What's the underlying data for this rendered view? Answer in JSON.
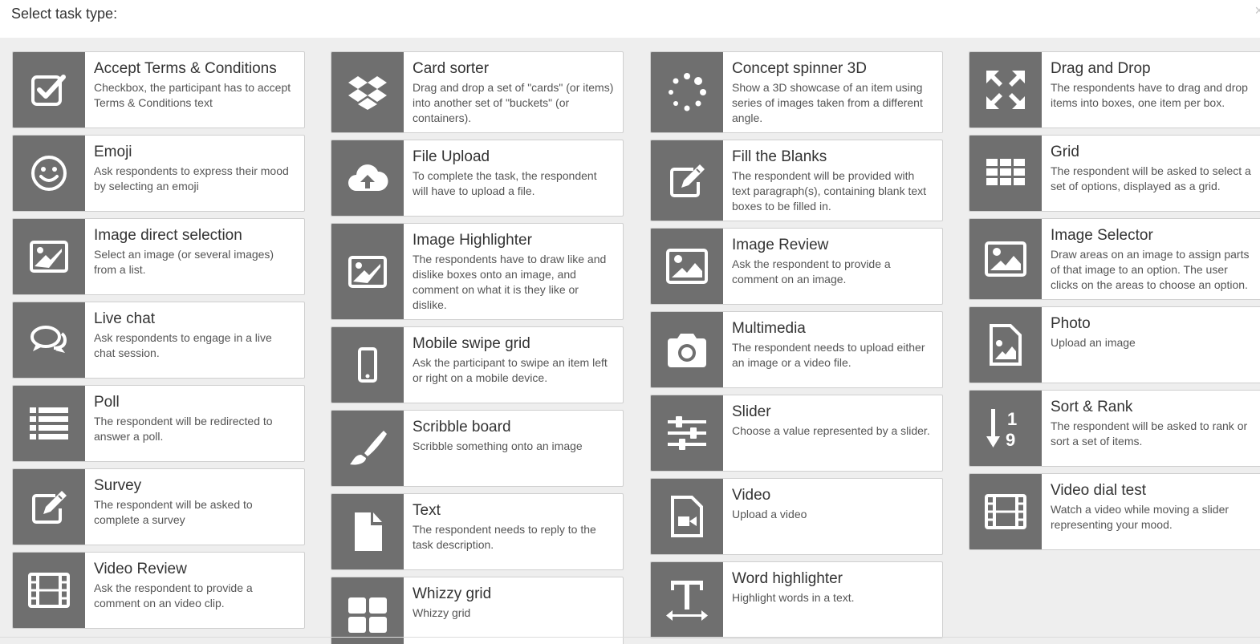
{
  "header": {
    "title": "Select task type:",
    "close_label": "×"
  },
  "columns": [
    [
      {
        "title": "Accept Terms & Conditions",
        "desc": "Checkbox, the participant has to accept Terms & Conditions text",
        "icon": "checkbox-icon"
      },
      {
        "title": "Emoji",
        "desc": "Ask respondents to express their mood by selecting an emoji",
        "icon": "smiley-icon"
      },
      {
        "title": "Image direct selection",
        "desc": "Select an image (or several images) from a list.",
        "icon": "image-selection-icon"
      },
      {
        "title": "Live chat",
        "desc": "Ask respondents to engage in a live chat session.",
        "icon": "chat-bubbles-icon"
      },
      {
        "title": "Poll",
        "desc": "The respondent will be redirected to answer a poll.",
        "icon": "list-icon"
      },
      {
        "title": "Survey",
        "desc": "The respondent will be asked to complete a survey",
        "icon": "edit-icon"
      },
      {
        "title": "Video Review",
        "desc": "Ask the respondent to provide a comment on an video clip.",
        "icon": "film-icon"
      }
    ],
    [
      {
        "title": "Card sorter",
        "desc": "Drag and drop a set of \"cards\" (or items) into another set of \"buckets\" (or containers).",
        "icon": "dropbox-icon"
      },
      {
        "title": "File Upload",
        "desc": "To complete the task, the respondent will have to upload a file.",
        "icon": "cloud-upload-icon"
      },
      {
        "title": "Image Highlighter",
        "desc": "The respondents have to draw like and dislike boxes onto an image, and comment on what it is they like or dislike.",
        "icon": "image-highlight-icon"
      },
      {
        "title": "Mobile swipe grid",
        "desc": "Ask the participant to swipe an item left or right on a mobile device.",
        "icon": "mobile-icon"
      },
      {
        "title": "Scribble board",
        "desc": "Scribble something onto an image",
        "icon": "paintbrush-icon"
      },
      {
        "title": "Text",
        "desc": "The respondent needs to reply to the task description.",
        "icon": "file-icon"
      },
      {
        "title": "Whizzy grid",
        "desc": "Whizzy grid",
        "icon": "grid-tiles-icon"
      }
    ],
    [
      {
        "title": "Concept spinner 3D",
        "desc": "Show a 3D showcase of an item using series of images taken from a different angle.",
        "icon": "spinner-icon"
      },
      {
        "title": "Fill the Blanks",
        "desc": "The respondent will be provided with text paragraph(s), containing blank text boxes to be filled in.",
        "icon": "edit-icon"
      },
      {
        "title": "Image Review",
        "desc": "Ask the respondent to provide a comment on an image.",
        "icon": "picture-icon"
      },
      {
        "title": "Multimedia",
        "desc": "The respondent needs to upload either an image or a video file.",
        "icon": "camera-icon"
      },
      {
        "title": "Slider",
        "desc": "Choose a value represented by a slider.",
        "icon": "sliders-icon"
      },
      {
        "title": "Video",
        "desc": "Upload a video",
        "icon": "video-file-icon"
      },
      {
        "title": "Word highlighter",
        "desc": "Highlight words in a text.",
        "icon": "text-width-icon"
      }
    ],
    [
      {
        "title": "Drag and Drop",
        "desc": "The respondents have to drag and drop items into boxes, one item per box.",
        "icon": "arrows-expand-icon"
      },
      {
        "title": "Grid",
        "desc": "The respondent will be asked to select a set of options, displayed as a grid.",
        "icon": "table-grid-icon"
      },
      {
        "title": "Image Selector",
        "desc": "Draw areas on an image to assign parts of that image to an option. The user clicks on the areas to choose an option.",
        "icon": "picture-icon"
      },
      {
        "title": "Photo",
        "desc": "Upload an image",
        "icon": "image-file-icon"
      },
      {
        "title": "Sort & Rank",
        "desc": "The respondent will be asked to rank or sort a set of items.",
        "icon": "sort-numeric-icon"
      },
      {
        "title": "Video dial test",
        "desc": "Watch a video while moving a slider representing your mood.",
        "icon": "film-icon"
      }
    ]
  ]
}
